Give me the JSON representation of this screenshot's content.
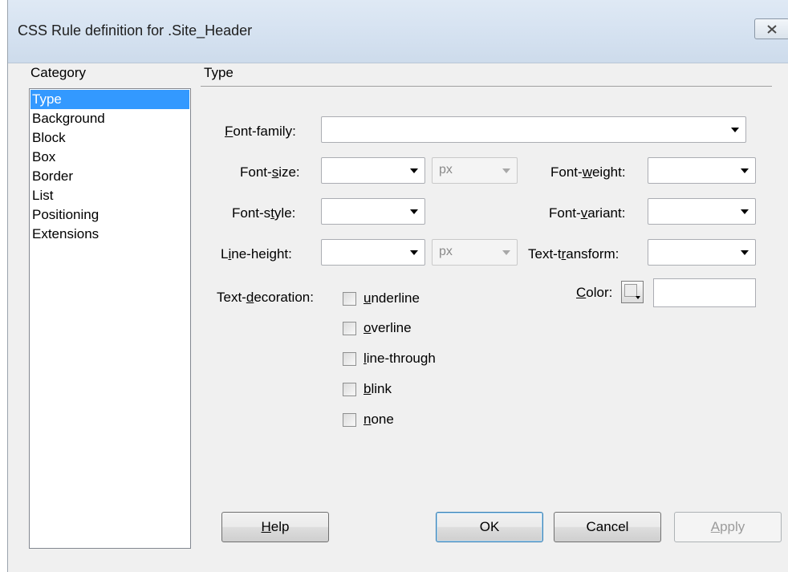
{
  "window": {
    "title": "CSS Rule definition for .Site_Header"
  },
  "category": {
    "heading": "Category",
    "items": [
      "Type",
      "Background",
      "Block",
      "Box",
      "Border",
      "List",
      "Positioning",
      "Extensions"
    ],
    "selected": "Type"
  },
  "panel": {
    "heading": "Type"
  },
  "fields": {
    "font_family": {
      "label_pre": "",
      "label_key": "F",
      "label_post": "ont-family:",
      "value": ""
    },
    "font_size": {
      "label_pre": "Font-",
      "label_key": "s",
      "label_post": "ize:",
      "value": "",
      "unit": "px"
    },
    "font_weight": {
      "label_pre": "Font-",
      "label_key": "w",
      "label_post": "eight:",
      "value": ""
    },
    "font_style": {
      "label_pre": "Font-s",
      "label_key": "t",
      "label_post": "yle:",
      "value": ""
    },
    "font_variant": {
      "label_pre": "Font-",
      "label_key": "v",
      "label_post": "ariant:",
      "value": ""
    },
    "line_height": {
      "label_pre": "L",
      "label_key": "i",
      "label_post": "ne-height:",
      "value": "",
      "unit": "px"
    },
    "text_transform": {
      "label_pre": "Text-t",
      "label_key": "r",
      "label_post": "ansform:",
      "value": ""
    },
    "color": {
      "label_pre": "",
      "label_key": "C",
      "label_post": "olor:",
      "value": ""
    }
  },
  "text_decoration": {
    "label_pre": "Text-",
    "label_key": "d",
    "label_post": "ecoration:",
    "options": [
      {
        "key": "u",
        "rest": "nderline",
        "checked": false
      },
      {
        "key": "o",
        "rest": "verline",
        "checked": false
      },
      {
        "key": "l",
        "rest": "ine-through",
        "checked": false
      },
      {
        "key": "b",
        "rest": "link",
        "checked": false
      },
      {
        "key": "n",
        "rest": "one",
        "checked": false
      }
    ]
  },
  "buttons": {
    "help": {
      "key": "H",
      "rest": "elp"
    },
    "ok": "OK",
    "cancel": "Cancel",
    "apply": {
      "key": "A",
      "rest": "pply"
    }
  },
  "colors": {
    "selection": "#3399ff",
    "titlebar": "#d4e1f0",
    "dialog_bg": "#f0f0f0"
  }
}
